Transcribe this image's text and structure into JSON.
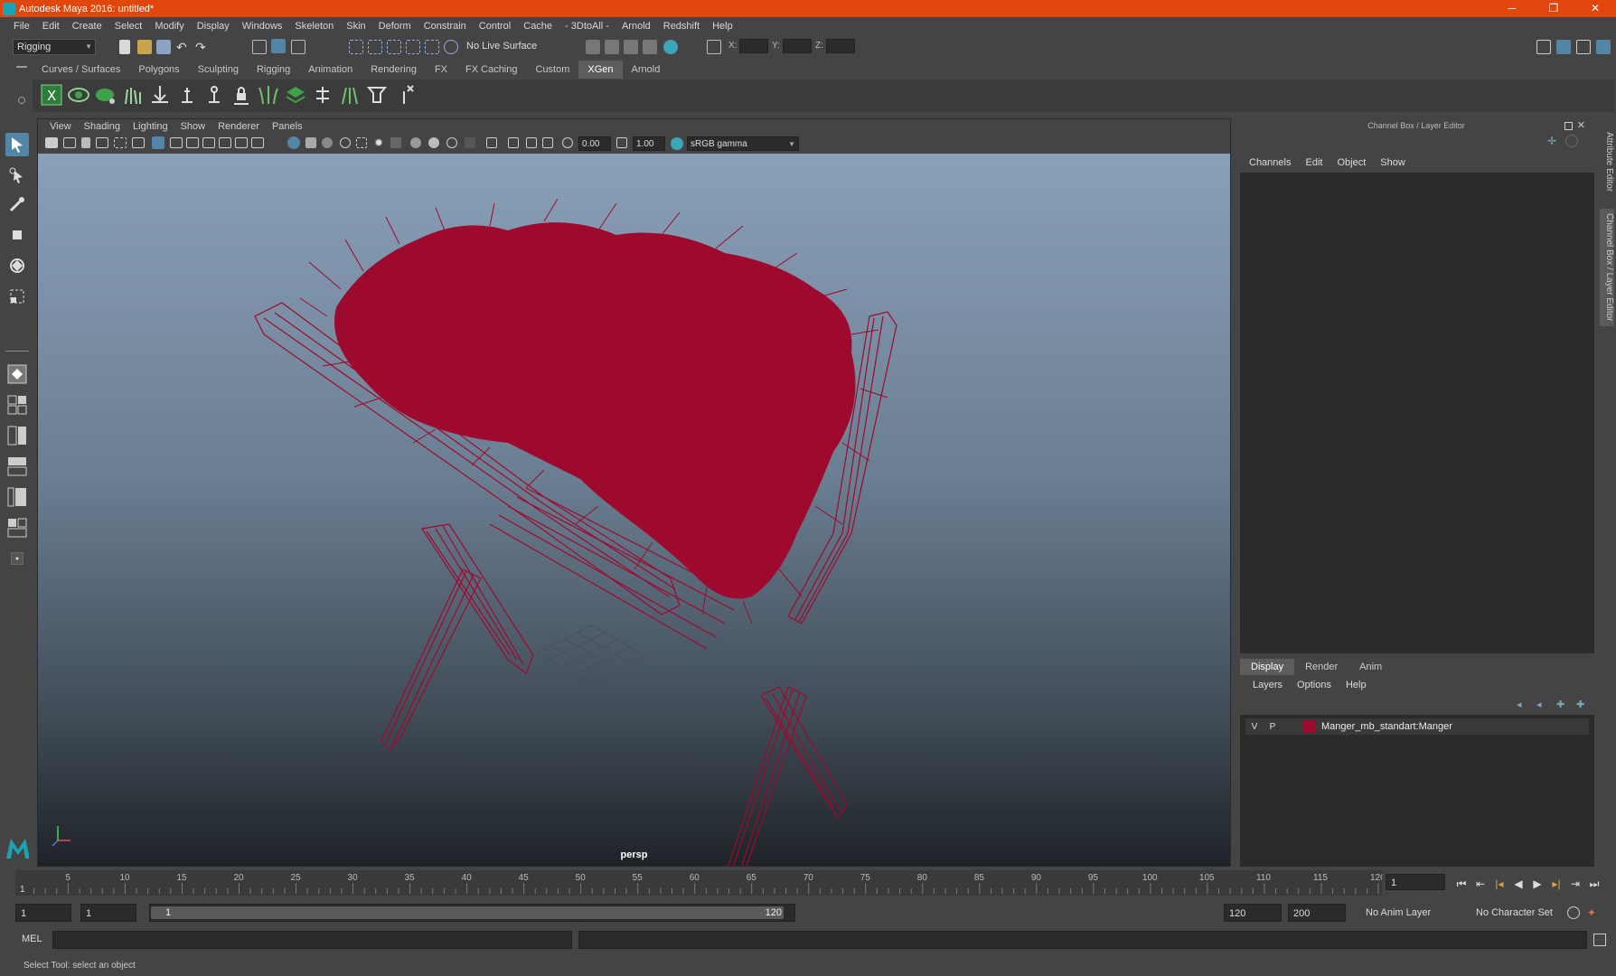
{
  "window": {
    "title": "Autodesk Maya 2016: untitled*",
    "min": "─",
    "max": "❐",
    "close": "✕"
  },
  "menubar": [
    "File",
    "Edit",
    "Create",
    "Select",
    "Modify",
    "Display",
    "Windows",
    "Skeleton",
    "Skin",
    "Deform",
    "Constrain",
    "Control",
    "Cache",
    "- 3DtoAll -",
    "Arnold",
    "Redshift",
    "Help"
  ],
  "statusline": {
    "mode": "Rigging",
    "live_surface": "No Live Surface",
    "x_label": "X:",
    "y_label": "Y:",
    "z_label": "Z:"
  },
  "shelf": {
    "tabs": [
      "Curves / Surfaces",
      "Polygons",
      "Sculpting",
      "Rigging",
      "Animation",
      "Rendering",
      "FX",
      "FX Caching",
      "Custom",
      "XGen",
      "Arnold"
    ],
    "active_tab": "XGen",
    "icons": [
      "xgen-editor-icon",
      "xgen-preview-icon",
      "xgen-visibility-icon",
      "xgen-place-guide-icon",
      "xgen-sculpt-guide-icon",
      "xgen-add-guide-icon",
      "xgen-select-guide-icon",
      "xgen-lock-guide-icon",
      "xgen-grass-icon",
      "xgen-layers-icon",
      "xgen-bend-guide-icon",
      "xgen-scale-guide-icon",
      "xgen-brush-icon",
      "xgen-delete-guide-icon"
    ]
  },
  "viewport": {
    "menu": [
      "View",
      "Shading",
      "Lighting",
      "Show",
      "Renderer",
      "Panels"
    ],
    "exposure": "0.00",
    "gamma": "1.00",
    "color_space": "sRGB gamma",
    "camera_label": "persp",
    "wire_color": "#9e0a2e"
  },
  "channel_box": {
    "title": "Channel Box / Layer Editor",
    "menu": [
      "Channels",
      "Edit",
      "Object",
      "Show"
    ],
    "layer_tabs": [
      "Display",
      "Render",
      "Anim"
    ],
    "active_layer_tab": "Display",
    "layer_menu": [
      "Layers",
      "Options",
      "Help"
    ],
    "layers": [
      {
        "v": "V",
        "p": "P",
        "color": "#9e0a2e",
        "name": "Manger_mb_standart:Manger"
      }
    ]
  },
  "side_tabs": [
    "Attribute Editor",
    "Channel Box / Layer Editor"
  ],
  "timeline": {
    "ticks": [
      "5",
      "10",
      "15",
      "20",
      "25",
      "30",
      "35",
      "40",
      "45",
      "50",
      "55",
      "60",
      "65",
      "70",
      "75",
      "80",
      "85",
      "90",
      "95",
      "100",
      "105",
      "110",
      "115",
      "120"
    ],
    "current_frame": "1",
    "current_frame_field": "1",
    "playback_icons": [
      "go-to-start-icon",
      "step-back-key-icon",
      "step-back-frame-icon",
      "play-back-icon",
      "play-forward-icon",
      "step-forward-frame-icon",
      "step-forward-key-icon",
      "go-to-end-icon"
    ]
  },
  "range": {
    "start": "1",
    "playback_start": "1",
    "slider_start": "1",
    "slider_end": "120",
    "playback_end": "120",
    "end": "200",
    "anim_layer": "No Anim Layer",
    "character_set": "No Character Set"
  },
  "command_line": {
    "label": "MEL"
  },
  "help_line": "Select Tool: select an object"
}
